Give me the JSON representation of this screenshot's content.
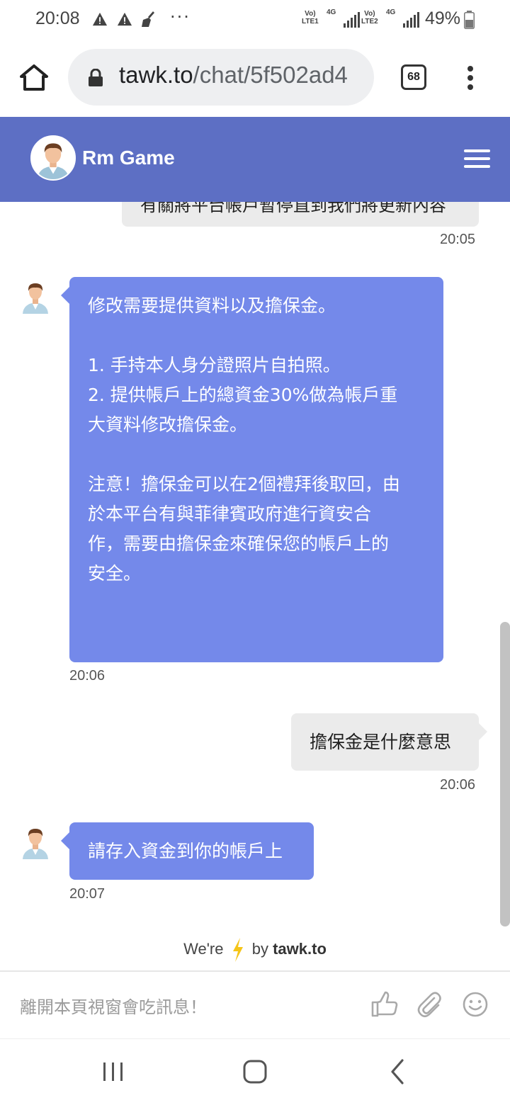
{
  "status_bar": {
    "time": "20:08",
    "net1_line1": "Vo)",
    "net1_line2": "LTE1",
    "net1_type": "4G",
    "net2_line1": "Vo)",
    "net2_line2": "LTE2",
    "net2_type": "4G",
    "battery": "49%",
    "overflow": "···"
  },
  "browser": {
    "url_domain": "tawk.to",
    "url_path": "/chat/5f502ad4",
    "tab_count": "68"
  },
  "header": {
    "title": "Rm Game"
  },
  "messages": [
    {
      "sender": "visitor",
      "text": "有關將平台帳戶暫停直到我們將更新內容",
      "time": "20:05"
    },
    {
      "sender": "agent",
      "text": "修改需要提供資料以及擔保金。\n\n1. 手持本人身分證照片自拍照。\n2. 提供帳戶上的總資金30%做為帳戶重\n大資料修改擔保金。\n\n注意！擔保金可以在2個禮拜後取回，由\n於本平台有與菲律賓政府進行資安合\n作，需要由擔保金來確保您的帳戶上的\n安全。\n\n\n-",
      "time": "20:06"
    },
    {
      "sender": "visitor",
      "text": "擔保金是什麼意思",
      "time": "20:06"
    },
    {
      "sender": "agent",
      "text": "請存入資金到你的帳戶上",
      "time": "20:07"
    }
  ],
  "branding": {
    "prefix": "We're",
    "middle": "by",
    "brand": "tawk.to"
  },
  "input": {
    "placeholder": "離開本頁視窗會吃訊息！"
  },
  "colors": {
    "header": "#5d6fc4",
    "agent_bubble": "#7489ea",
    "visitor_bubble": "#ebebeb",
    "bolt": "#f5c518"
  },
  "icons": {
    "home": "home-icon",
    "lock": "lock-icon",
    "menu": "hamburger-icon",
    "like": "thumbs-up-icon",
    "attach": "paperclip-icon",
    "emoji": "smiley-icon"
  }
}
